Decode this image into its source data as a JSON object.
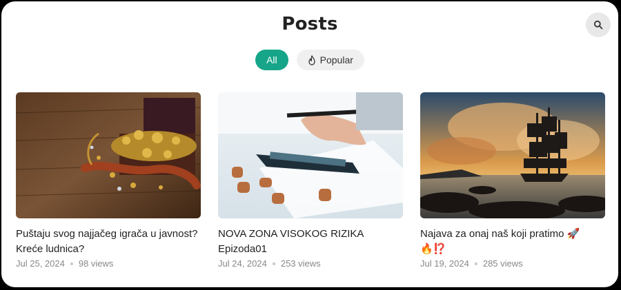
{
  "page": {
    "title": "Posts"
  },
  "tabs": [
    {
      "label": "All",
      "active": true
    },
    {
      "label": "Popular",
      "active": false,
      "icon": "flame-icon"
    }
  ],
  "search": {
    "icon": "search-icon"
  },
  "colors": {
    "accent": "#17a589"
  },
  "posts": [
    {
      "title": "Puštaju svog najjačeg igrača u javnost? Kreće ludnica?",
      "date": "Jul 25, 2024",
      "views": "98 views",
      "image": "treasure-chest-image"
    },
    {
      "title": "NOVA ZONA VISOKOG RIZIKA Epizoda01",
      "date": "Jul 24, 2024",
      "views": "253 views",
      "image": "calculator-coins-image"
    },
    {
      "title": "Najava za onaj naš koji pratimo 🚀🔥⁉️",
      "date": "Jul 19, 2024",
      "views": "285 views",
      "image": "pirate-ship-sunset-image"
    }
  ]
}
